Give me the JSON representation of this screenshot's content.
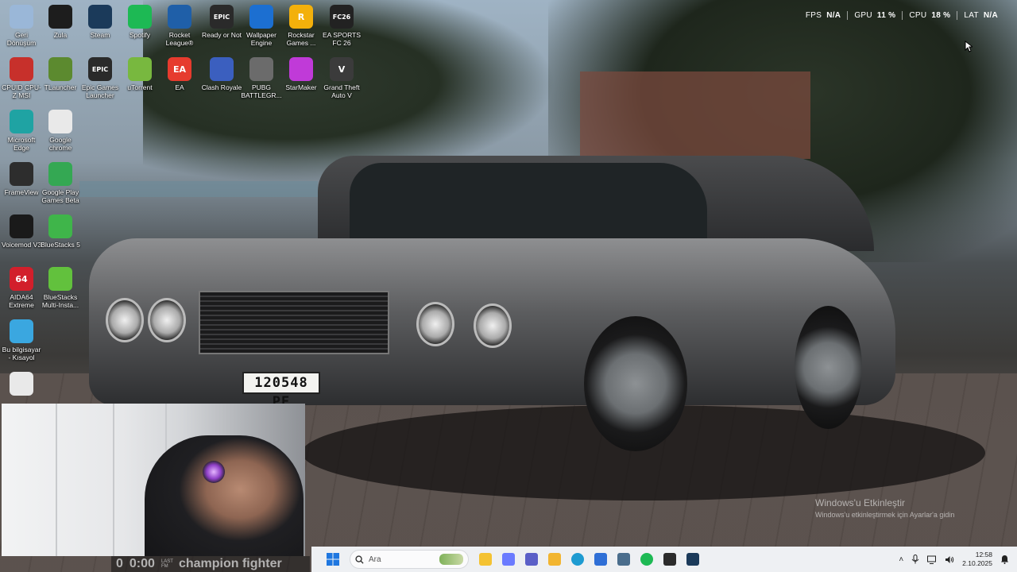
{
  "desktop_icons": [
    {
      "label": "Geri Dönüşüm",
      "icon": "recycle-bin-icon",
      "color": "#9ab7d8"
    },
    {
      "label": "Zula",
      "icon": "zula-icon",
      "color": "#1d1d1d"
    },
    {
      "label": "Steam",
      "icon": "steam-icon",
      "color": "#1b3a5a"
    },
    {
      "label": "Spotify",
      "icon": "spotify-icon",
      "color": "#1db954"
    },
    {
      "label": "Rocket League®",
      "icon": "rocket-league-icon",
      "color": "#1f5fa8"
    },
    {
      "label": "Ready or Not",
      "icon": "epic-games-icon",
      "color": "#2a2a2a",
      "glyph": "EPIC"
    },
    {
      "label": "Wallpaper Engine",
      "icon": "wallpaper-engine-icon",
      "color": "#1c6fd1"
    },
    {
      "label": "Rockstar Games ...",
      "icon": "rockstar-icon",
      "color": "#f3b00b",
      "glyph": "R"
    },
    {
      "label": "EA SPORTS FC 26",
      "icon": "ea-fc-icon",
      "color": "#222",
      "glyph": "FC26"
    },
    {
      "label": "CPUID CPU-Z MSI",
      "icon": "cpuz-icon",
      "color": "#c7302b"
    },
    {
      "label": "TLauncher",
      "icon": "tlauncher-icon",
      "color": "#5c8a2f"
    },
    {
      "label": "Epic Games Launcher",
      "icon": "epic-games-icon",
      "color": "#2a2a2a",
      "glyph": "EPIC"
    },
    {
      "label": "uTorrent",
      "icon": "utorrent-icon",
      "color": "#78b83f"
    },
    {
      "label": "EA",
      "icon": "ea-icon",
      "color": "#e63b2e",
      "glyph": "EA"
    },
    {
      "label": "Clash Royale",
      "icon": "clash-royale-icon",
      "color": "#3b5fbf"
    },
    {
      "label": "PUBG BATTLEGR...",
      "icon": "pubg-icon",
      "color": "#6b6b6b"
    },
    {
      "label": "StarMaker",
      "icon": "starmaker-icon",
      "color": "#c03ad8"
    },
    {
      "label": "Grand Theft Auto V",
      "icon": "gta-icon",
      "color": "#3b3b3b",
      "glyph": "V"
    },
    {
      "label": "Microsoft Edge",
      "icon": "edge-icon",
      "color": "#1fa3a3"
    },
    {
      "label": "Google chrome",
      "icon": "chrome-icon",
      "color": "#e9e9e9"
    },
    {
      "label": "FrameView",
      "icon": "frameview-icon",
      "color": "#2d2d2d"
    },
    {
      "label": "Google Play Games Beta",
      "icon": "google-play-games-icon",
      "color": "#34a853"
    },
    {
      "label": "Voicemod V3",
      "icon": "voicemod-icon",
      "color": "#1a1a1a"
    },
    {
      "label": "BlueStacks 5",
      "icon": "bluestacks-icon",
      "color": "#3fb54a"
    },
    {
      "label": "AIDA64 Extreme",
      "icon": "aida64-icon",
      "color": "#d21f2b",
      "glyph": "64"
    },
    {
      "label": "BlueStacks Multi-Insta...",
      "icon": "bluestacks-multi-icon",
      "color": "#62c13d"
    },
    {
      "label": "Bu bilgisayar - Kısayol",
      "icon": "this-pc-icon",
      "color": "#3aa7e0"
    },
    {
      "label": "",
      "icon": "chrome-icon",
      "color": "#e9e9e9"
    }
  ],
  "perf": {
    "fps_label": "FPS",
    "fps_value": "N/A",
    "gpu_label": "GPU",
    "gpu_value": "11 %",
    "cpu_label": "CPU",
    "cpu_value": "18 %",
    "lat_label": "LAT",
    "lat_value": "N/A"
  },
  "plate": "120548 PE",
  "watermark": {
    "title": "Windows'u Etkinleştir",
    "subtitle": "Windows'u etkinleştirmek için Ayarlar'a gidin"
  },
  "overlay": {
    "score": "0",
    "time": "0:00",
    "small_top": "LAST",
    "small_bottom": "FM",
    "text": "champion fighter"
  },
  "taskbar": {
    "search_placeholder": "Ara",
    "apps": [
      {
        "icon": "file-explorer-icon",
        "color": "#f4c232"
      },
      {
        "icon": "copilot-icon",
        "color": "#6b7bff"
      },
      {
        "icon": "teams-icon",
        "color": "#5b5fc7"
      },
      {
        "icon": "folder-icon",
        "color": "#f2b531"
      },
      {
        "icon": "edge-icon",
        "color": "#1e9bd1"
      },
      {
        "icon": "store-icon",
        "color": "#2f6fd6"
      },
      {
        "icon": "network-app-icon",
        "color": "#4a6d8c"
      },
      {
        "icon": "spotify-icon",
        "color": "#1db954"
      },
      {
        "icon": "discord-like-icon",
        "color": "#2b2b2b"
      },
      {
        "icon": "steam-icon",
        "color": "#1b3a5a"
      }
    ],
    "time": "12:58",
    "date": "2.10.2025"
  }
}
